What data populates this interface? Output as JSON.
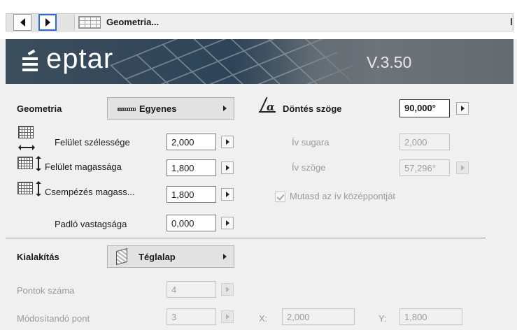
{
  "nav": {
    "title": "Geometria..."
  },
  "banner": {
    "brand": "eptar",
    "version": "V.3.50"
  },
  "geometry": {
    "section_label": "Geometria",
    "type_value": "Egyenes",
    "surface_width_label": "Felület szélessége",
    "surface_width_value": "2,000",
    "surface_height_label": "Felület magassága",
    "surface_height_value": "1,800",
    "tiling_height_label": "Csempézés magass...",
    "tiling_height_value": "1,800",
    "floor_thickness_label": "Padló vastagsága",
    "floor_thickness_value": "0,000"
  },
  "angle": {
    "tilt_label": "Döntés szöge",
    "tilt_value": "90,000°",
    "arc_radius_label": "Ív sugara",
    "arc_radius_value": "2,000",
    "arc_angle_label": "Ív szöge",
    "arc_angle_value": "57,296°",
    "show_center_label": "Mutasd az ív középpontját",
    "show_center_checked": true
  },
  "layout": {
    "section_label": "Kialakítás",
    "shape_value": "Téglalap",
    "point_count_label": "Pontok száma",
    "point_count_value": "4",
    "edit_point_label": "Módosítandó pont",
    "edit_point_value": "3",
    "x_label": "X:",
    "x_value": "2,000",
    "y_label": "Y:",
    "y_value": "1,800"
  },
  "colors": {
    "accent": "#2a6fd6",
    "banner": "#34485a",
    "disabled_text": "#9a9a9a"
  }
}
